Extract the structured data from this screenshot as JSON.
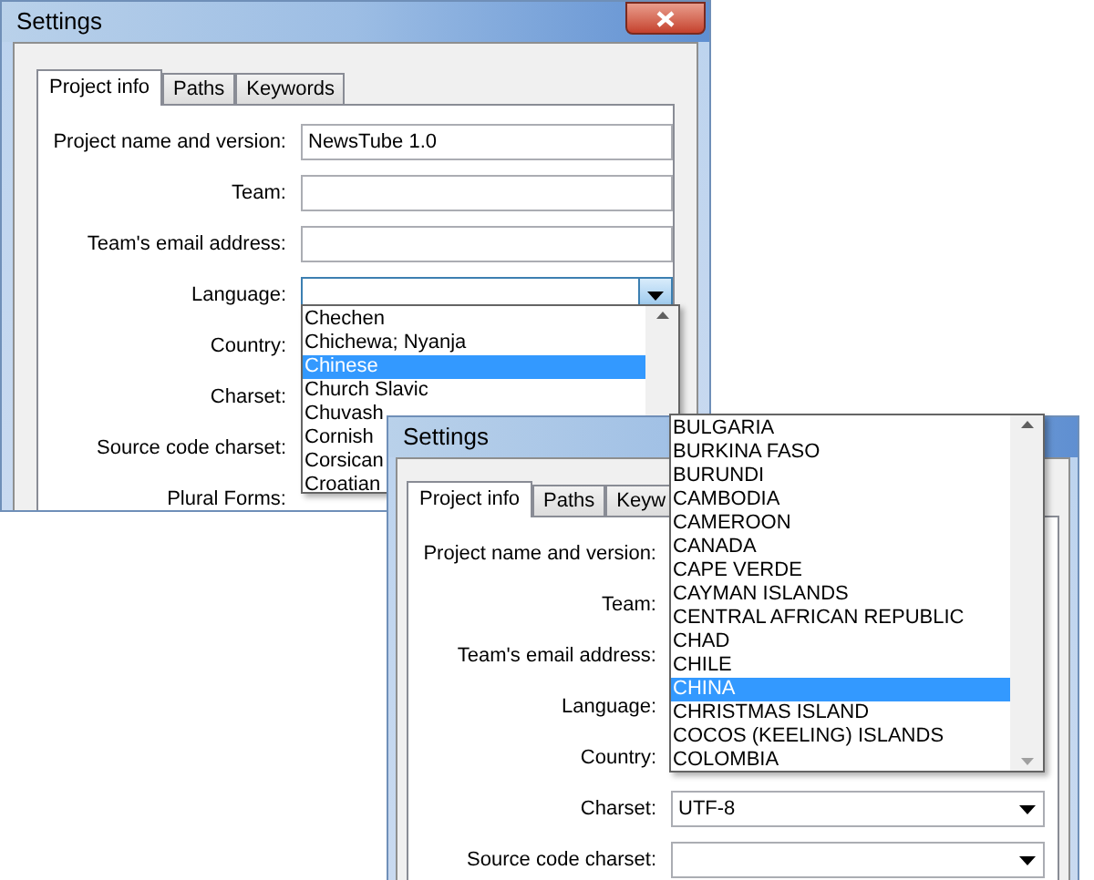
{
  "windows": [
    {
      "title": "Settings",
      "close_visible": true,
      "tabs": [
        {
          "label": "Project info",
          "selected": true
        },
        {
          "label": "Paths",
          "selected": false
        },
        {
          "label": "Keywords",
          "selected": false
        }
      ],
      "fields": [
        {
          "label": "Project name and version:",
          "kind": "text",
          "value": "NewsTube 1.0"
        },
        {
          "label": "Team:",
          "kind": "text"
        },
        {
          "label": "Team's email address:",
          "kind": "text"
        },
        {
          "label": "Language:",
          "kind": "combo",
          "open": true
        },
        {
          "label": "Country:",
          "kind": "covered"
        },
        {
          "label": "Charset:",
          "kind": "covered"
        },
        {
          "label": "Source code charset:",
          "kind": "covered"
        },
        {
          "label": "Plural Forms:",
          "kind": "covered"
        }
      ],
      "list": [
        {
          "label": "Chechen",
          "selected": false
        },
        {
          "label": "Chichewa; Nyanja",
          "selected": false
        },
        {
          "label": "Chinese",
          "selected": true
        },
        {
          "label": "Church Slavic",
          "selected": false
        },
        {
          "label": "Chuvash",
          "selected": false
        },
        {
          "label": "Cornish",
          "selected": false
        },
        {
          "label": "Corsican",
          "selected": false
        },
        {
          "label": "Croatian",
          "selected": false
        }
      ]
    },
    {
      "title": "Settings",
      "close_visible": false,
      "tabs": [
        {
          "label": "Project info",
          "selected": true
        },
        {
          "label": "Paths",
          "selected": false
        },
        {
          "label": "Keyw",
          "selected": false
        }
      ],
      "fields": [
        {
          "label": "Project name and version:",
          "kind": "covered"
        },
        {
          "label": "Team:",
          "kind": "covered"
        },
        {
          "label": "Team's email address:",
          "kind": "covered"
        },
        {
          "label": "Language:",
          "kind": "covered"
        },
        {
          "label": "Country:",
          "kind": "covered"
        },
        {
          "label": "Charset:",
          "kind": "combo",
          "value": "UTF-8",
          "open": false
        },
        {
          "label": "Source code charset:",
          "kind": "combo",
          "open": false
        }
      ],
      "list": [
        {
          "label": "BULGARIA",
          "selected": false
        },
        {
          "label": "BURKINA FASO",
          "selected": false
        },
        {
          "label": "BURUNDI",
          "selected": false
        },
        {
          "label": "CAMBODIA",
          "selected": false
        },
        {
          "label": "CAMEROON",
          "selected": false
        },
        {
          "label": "CANADA",
          "selected": false
        },
        {
          "label": "CAPE VERDE",
          "selected": false
        },
        {
          "label": "CAYMAN ISLANDS",
          "selected": false
        },
        {
          "label": "CENTRAL AFRICAN REPUBLIC",
          "selected": false
        },
        {
          "label": "CHAD",
          "selected": false
        },
        {
          "label": "CHILE",
          "selected": false
        },
        {
          "label": "CHINA",
          "selected": true
        },
        {
          "label": "CHRISTMAS ISLAND",
          "selected": false
        },
        {
          "label": "COCOS (KEELING) ISLANDS",
          "selected": false
        },
        {
          "label": "COLOMBIA",
          "selected": false
        }
      ]
    }
  ]
}
